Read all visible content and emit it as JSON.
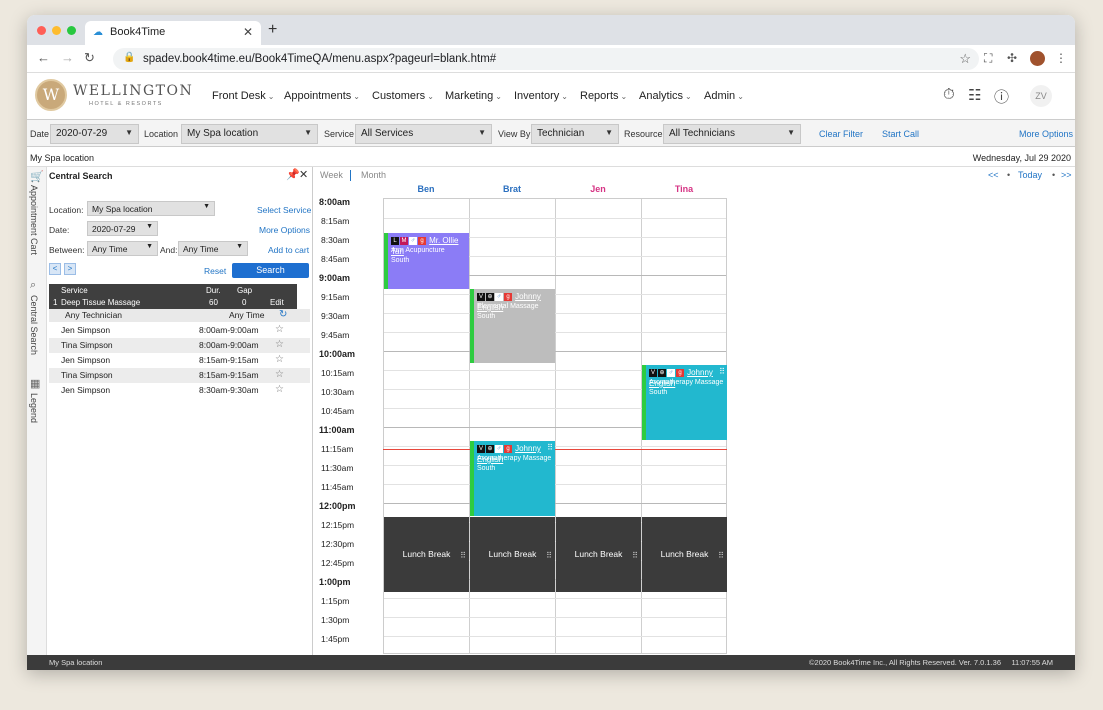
{
  "browser": {
    "tab_title": "Book4Time",
    "url": "spadev.book4time.eu/Book4TimeQA/menu.aspx?pageurl=blank.htm#"
  },
  "brand": {
    "name": "WELLINGTON",
    "subtitle": "HOTEL & RESORTS",
    "monogram": "W"
  },
  "menu": [
    {
      "label": "Front Desk"
    },
    {
      "label": "Appointments"
    },
    {
      "label": "Customers"
    },
    {
      "label": "Marketing"
    },
    {
      "label": "Inventory"
    },
    {
      "label": "Reports"
    },
    {
      "label": "Analytics"
    },
    {
      "label": "Admin"
    }
  ],
  "user_initials": "ZV",
  "filters": {
    "date_label": "Date",
    "date_value": "2020-07-29",
    "location_label": "Location",
    "location_value": "My Spa location",
    "service_label": "Service",
    "service_value": "All Services",
    "viewby_label": "View By",
    "viewby_value": "Technician",
    "resource_label": "Resource",
    "resource_value": "All Technicians",
    "clear_filter": "Clear Filter",
    "start_call": "Start Call",
    "more_options": "More Options"
  },
  "location_strip": {
    "left": "My Spa location",
    "right": "Wednesday, Jul 29 2020"
  },
  "rail": {
    "cart": "Appointment Cart",
    "search": "Central Search",
    "legend": "Legend"
  },
  "search_panel": {
    "title": "Central Search",
    "location_label": "Location:",
    "location_value": "My Spa location",
    "select_service": "Select Service",
    "date_label": "Date:",
    "date_value": "2020-07-29",
    "more_options": "More Options",
    "between_label": "Between:",
    "between_value": "Any Time",
    "and_label": "And:",
    "and_value": "Any Time",
    "add_to_cart": "Add to cart",
    "prev": "<",
    "next": ">",
    "reset": "Reset",
    "search": "Search",
    "service_table": {
      "h_service": "Service",
      "h_dur": "Dur.",
      "h_gap": "Gap",
      "num": "1",
      "service": "Deep Tissue Massage",
      "dur": "60",
      "gap": "0",
      "edit": "Edit"
    },
    "tech_filter": "Any Technician",
    "time_filter": "Any Time",
    "results": [
      {
        "tech": "Jen Simpson",
        "time": "8:00am-9:00am"
      },
      {
        "tech": "Tina Simpson",
        "time": "8:00am-9:00am"
      },
      {
        "tech": "Jen Simpson",
        "time": "8:15am-9:15am"
      },
      {
        "tech": "Tina Simpson",
        "time": "8:15am-9:15am"
      },
      {
        "tech": "Jen Simpson",
        "time": "8:30am-9:30am"
      }
    ]
  },
  "calendar": {
    "week": "Week",
    "month": "Month",
    "nav_prev": "<<",
    "today": "Today",
    "nav_next": ">>",
    "columns": [
      {
        "name": "Ben",
        "color": "#2a6fbf"
      },
      {
        "name": "Brat",
        "color": "#2a6fbf"
      },
      {
        "name": "Jen",
        "color": "#d63384"
      },
      {
        "name": "Tina",
        "color": "#d63384"
      }
    ],
    "times": [
      "8:00am",
      "8:15am",
      "8:30am",
      "8:45am",
      "9:00am",
      "9:15am",
      "9:30am",
      "9:45am",
      "10:00am",
      "10:15am",
      "10:30am",
      "10:45am",
      "11:00am",
      "11:15am",
      "11:30am",
      "11:45am",
      "12:00pm",
      "12:15pm",
      "12:30pm",
      "12:45pm",
      "1:00pm",
      "1:15pm",
      "1:30pm",
      "1:45pm"
    ],
    "appointments": [
      {
        "tags": "L M ♂ g",
        "client": "Mr. Ollie Tan",
        "service": "Arm Acupuncture",
        "room": "South",
        "color": "#8b7cf6"
      },
      {
        "tags": "V ⊕ ♂ g",
        "client": "Johnny English",
        "service": "Elemental Massage",
        "room": "South",
        "color": "#bdbdbd"
      },
      {
        "tags": "V ⊕ ♂ g",
        "client": "Johnny English",
        "service": "Aromatherapy Massage",
        "room": "South",
        "color": "#22b8cf"
      },
      {
        "tags": "V ⊕ ♂ g",
        "client": "Johnny English",
        "service": "Aromatherapy Massage",
        "room": "South",
        "color": "#22b8cf"
      }
    ],
    "lunch_label": "Lunch Break"
  },
  "status": {
    "left": "My Spa location",
    "right": "©2020 Book4Time Inc., All Rights Reserved. Ver. 7.0.1.36     11:07:55 AM"
  }
}
